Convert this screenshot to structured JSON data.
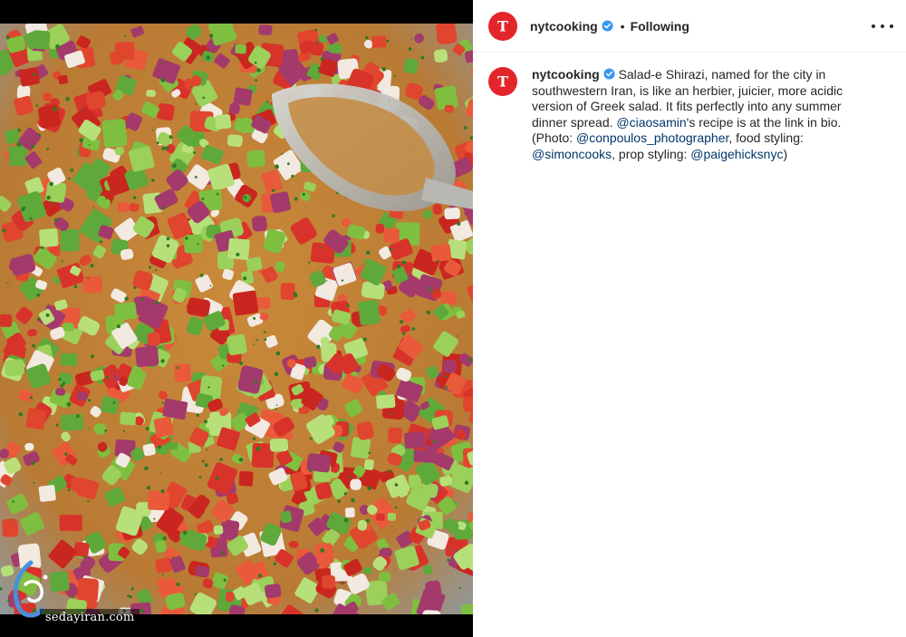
{
  "post": {
    "username": "nytcooking",
    "follow_status": "Following",
    "separator": "•",
    "verified_icon": "verified-badge-icon",
    "avatar_icon": "nyt-t-logo-icon",
    "more_icon": "more-options-icon"
  },
  "caption": {
    "username": "nytcooking",
    "segments": [
      {
        "type": "text",
        "text": "Salad-e Shirazi, named for the city in southwestern Iran, is like an herbier, juicier, more acidic version of Greek salad. It fits perfectly into any summer dinner spread. "
      },
      {
        "type": "mention",
        "text": "@ciaosamin"
      },
      {
        "type": "text",
        "text": "'s recipe is at the link in bio. (Photo: "
      },
      {
        "type": "mention",
        "text": "@conpoulos_photographer"
      },
      {
        "type": "text",
        "text": ", food styling: "
      },
      {
        "type": "mention",
        "text": "@simoncooks"
      },
      {
        "type": "text",
        "text": ", prop styling: "
      },
      {
        "type": "mention",
        "text": "@paigehicksnyc"
      },
      {
        "type": "text",
        "text": ")"
      }
    ]
  },
  "media": {
    "subject": "shirazi-salad-photo",
    "watermark_text": "sedayiran.com"
  },
  "colors": {
    "brand_red": "#e4262c",
    "verified_blue": "#3897f0",
    "mention_blue": "#00376b",
    "text": "#262626"
  }
}
